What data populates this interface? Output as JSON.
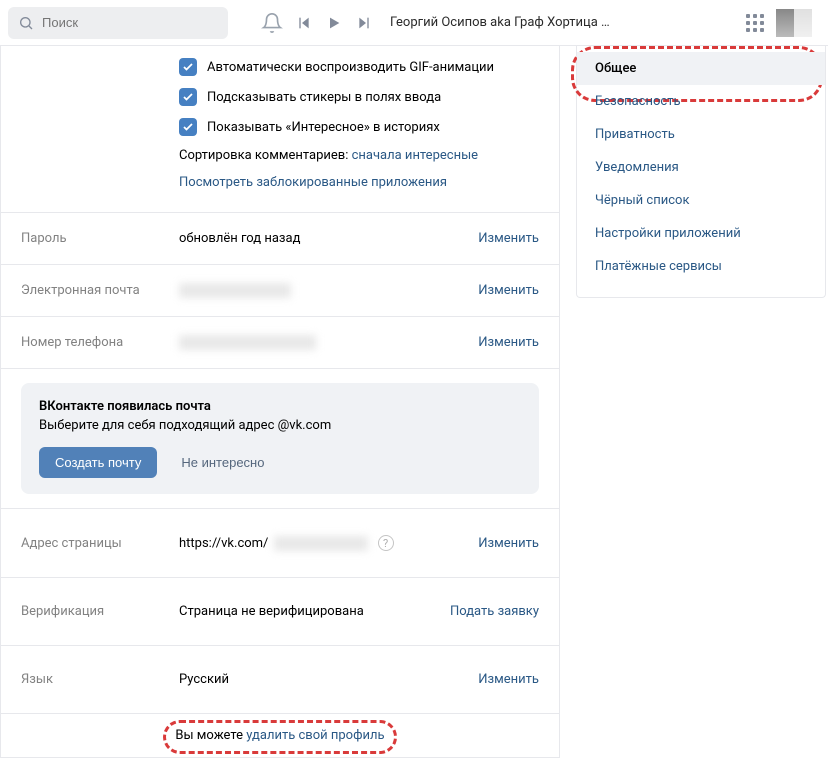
{
  "header": {
    "search_placeholder": "Поиск",
    "track": "Георгий Осипов aka Граф Хортица …"
  },
  "checks": {
    "gif": "Автоматически воспроизводить GIF-анимации",
    "stickers": "Подсказывать стикеры в полях ввода",
    "interesting": "Показывать «Интересное» в историях"
  },
  "sort": {
    "label": "Сортировка комментариев: ",
    "value": "сначала интересные"
  },
  "blocked_link": "Посмотреть заблокированные приложения",
  "rows": {
    "password": {
      "label": "Пароль",
      "value": "обновлён год назад",
      "action": "Изменить"
    },
    "email": {
      "label": "Электронная почта",
      "action": "Изменить"
    },
    "phone": {
      "label": "Номер телефона",
      "action": "Изменить"
    },
    "address": {
      "label": "Адрес страницы",
      "prefix": "https://vk.com/",
      "action": "Изменить"
    },
    "verify": {
      "label": "Верификация",
      "value": "Страница не верифицирована",
      "action": "Подать заявку"
    },
    "lang": {
      "label": "Язык",
      "value": "Русский",
      "action": "Изменить"
    }
  },
  "promo": {
    "title": "ВКонтакте появилась почта",
    "sub": "Выберите для себя подходящий адрес @vk.com",
    "primary": "Создать почту",
    "secondary": "Не интересно"
  },
  "footer": {
    "text": "Вы можете ",
    "link": "удалить свой профиль"
  },
  "sidebar": {
    "items": [
      "Общее",
      "Безопасность",
      "Приватность",
      "Уведомления",
      "Чёрный список",
      "Настройки приложений",
      "Платёжные сервисы"
    ]
  }
}
